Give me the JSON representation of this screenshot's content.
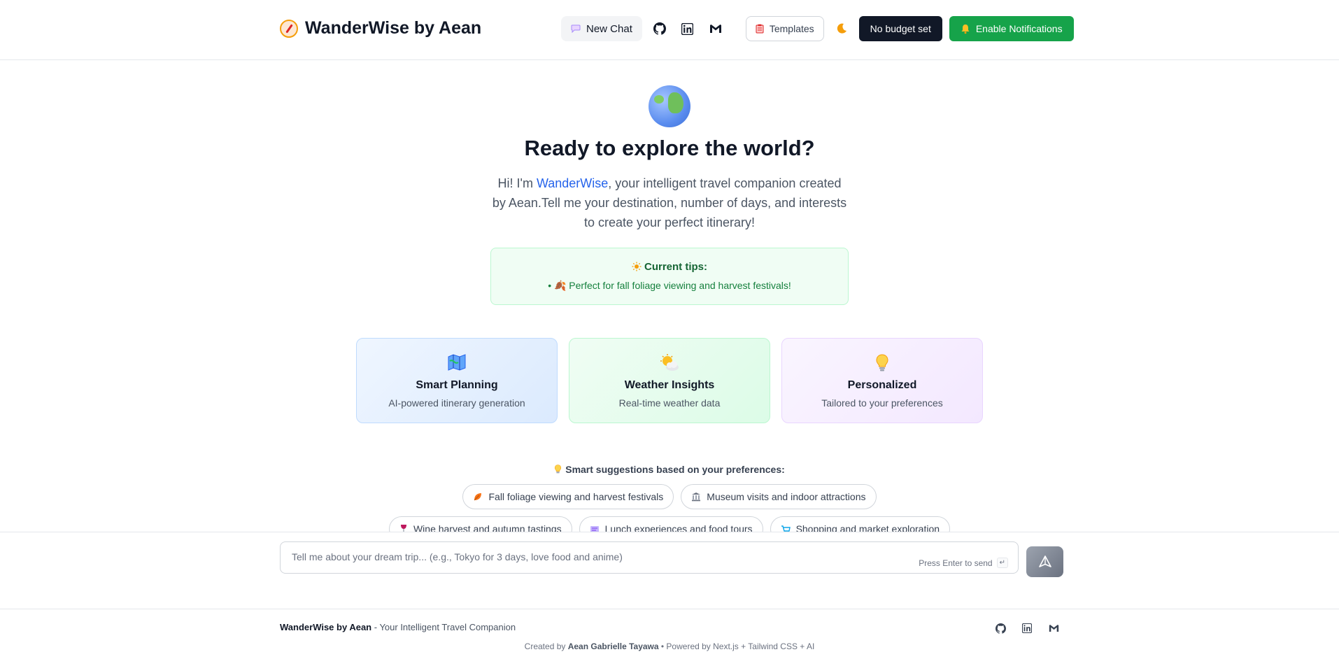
{
  "header": {
    "app_title": "WanderWise by Aean",
    "new_chat_label": "New Chat",
    "templates_label": "Templates",
    "budget_label": "No budget set",
    "notifications_label": "Enable Notifications"
  },
  "hero": {
    "headline": "Ready to explore the world?",
    "intro_prefix": "Hi! I'm ",
    "intro_highlight": "WanderWise",
    "intro_suffix": ", your intelligent travel companion created by Aean.Tell me your destination, number of days, and interests to create your perfect itinerary!"
  },
  "tips": {
    "title": "Current tips:",
    "items": [
      "• 🍂 Perfect for fall foliage viewing and harvest festivals!"
    ]
  },
  "features": [
    {
      "title": "Smart Planning",
      "desc": "AI-powered itinerary generation",
      "icon": "map-icon"
    },
    {
      "title": "Weather Insights",
      "desc": "Real-time weather data",
      "icon": "weather-icon"
    },
    {
      "title": "Personalized",
      "desc": "Tailored to your preferences",
      "icon": "lightbulb-icon"
    }
  ],
  "suggestions": {
    "title": "Smart suggestions based on your preferences:",
    "chips": [
      "Fall foliage viewing and harvest festivals",
      "Museum visits and indoor attractions",
      "Wine harvest and autumn tastings",
      "Lunch experiences and food tours",
      "Shopping and market exploration"
    ]
  },
  "composer": {
    "placeholder": "Tell me about your dream trip... (e.g., Tokyo for 3 days, love food and anime)",
    "hint": "Press Enter to send",
    "kbd": "↵"
  },
  "footer": {
    "brand": "WanderWise by Aean",
    "tagline": " - Your Intelligent Travel Companion",
    "created_prefix": "Created by ",
    "author": "Aean Gabrielle Tayawa",
    "powered": " • Powered by Next.js + Tailwind CSS + AI"
  },
  "colors": {
    "accent": "#2563eb",
    "notify": "#16a34a",
    "budget": "#111827"
  }
}
